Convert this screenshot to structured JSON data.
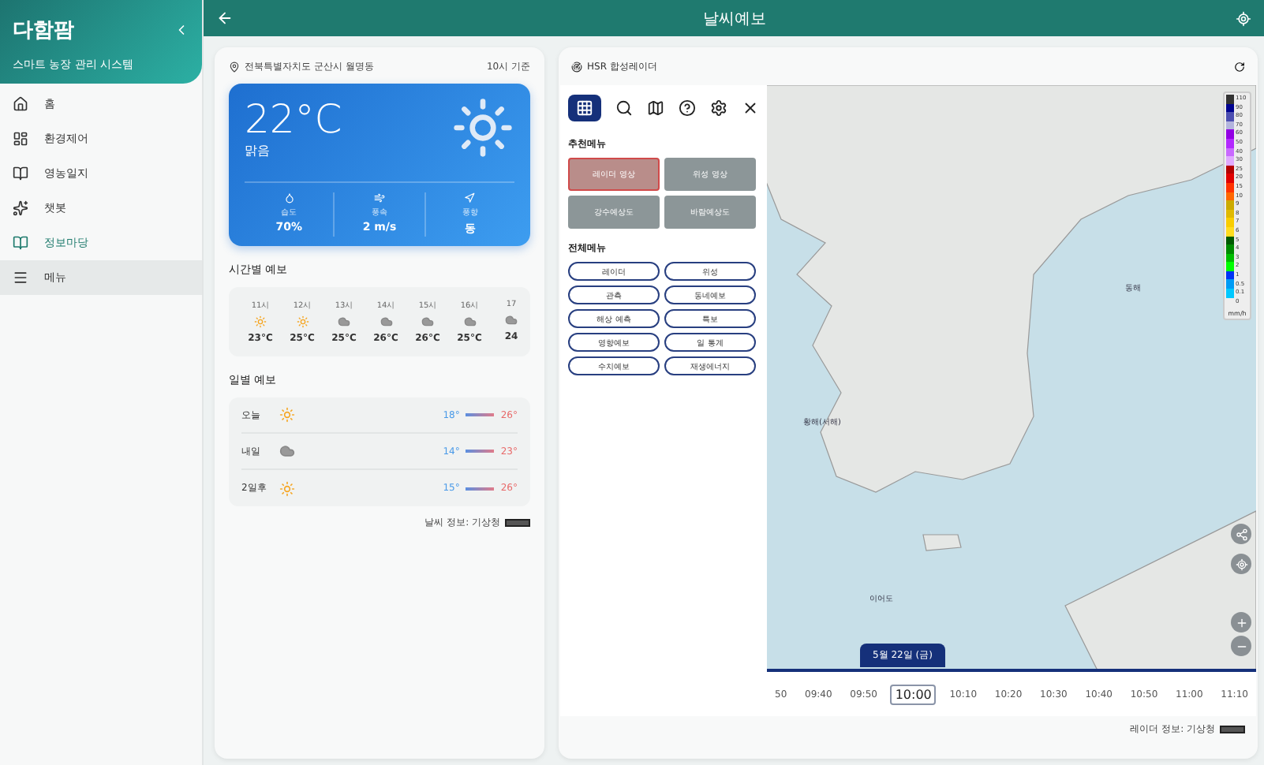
{
  "sidebar": {
    "brand": "다함팜",
    "subtitle": "스마트 농장 관리 시스템",
    "items": [
      {
        "label": "홈",
        "selected": false,
        "highlighted": false
      },
      {
        "label": "환경제어",
        "selected": false,
        "highlighted": false
      },
      {
        "label": "영농일지",
        "selected": false,
        "highlighted": false
      },
      {
        "label": "챗봇",
        "selected": false,
        "highlighted": false
      },
      {
        "label": "정보마당",
        "selected": true,
        "highlighted": false
      },
      {
        "label": "메뉴",
        "selected": false,
        "highlighted": true
      }
    ]
  },
  "top_bar": {
    "title": "날씨예보"
  },
  "weather": {
    "location": "전북특별자치도 군산시 월명동",
    "basis": "10시 기준",
    "temperature": "22°C",
    "condition": "맑음",
    "stats": [
      {
        "kind": "humidity",
        "label": "습도",
        "value": "70%"
      },
      {
        "kind": "wind",
        "label": "풍속",
        "value": "2 m/s"
      },
      {
        "kind": "direction",
        "label": "풍향",
        "value": "동"
      }
    ],
    "hourly_title": "시간별 예보",
    "hourly": [
      {
        "time": "11시",
        "kind": "sun",
        "temp": "23°C"
      },
      {
        "time": "12시",
        "kind": "sun",
        "temp": "25°C"
      },
      {
        "time": "13시",
        "kind": "cloud",
        "temp": "25°C"
      },
      {
        "time": "14시",
        "kind": "cloud",
        "temp": "26°C"
      },
      {
        "time": "15시",
        "kind": "cloud",
        "temp": "26°C"
      },
      {
        "time": "16시",
        "kind": "cloud",
        "temp": "25°C"
      },
      {
        "time": "17",
        "kind": "cloud",
        "temp": "24"
      }
    ],
    "daily_title": "일별 예보",
    "daily": [
      {
        "day": "오늘",
        "kind": "sun",
        "low": "18°",
        "high": "26°"
      },
      {
        "day": "내일",
        "kind": "cloud",
        "low": "14°",
        "high": "23°"
      },
      {
        "day": "2일후",
        "kind": "sun",
        "low": "15°",
        "high": "26°"
      }
    ],
    "source": "날씨 정보: 기상청"
  },
  "radar": {
    "title": "HSR 합성레이더",
    "tools": [
      {
        "kind": "grid",
        "selected": true
      },
      {
        "kind": "search",
        "selected": false
      },
      {
        "kind": "map",
        "selected": false
      },
      {
        "kind": "help",
        "selected": false
      },
      {
        "kind": "settings",
        "selected": false
      }
    ],
    "recommended_title": "추천메뉴",
    "recommended": [
      {
        "label": "레이더 영상",
        "selected": true
      },
      {
        "label": "위성 영상",
        "selected": false
      },
      {
        "label": "강수예상도",
        "selected": false
      },
      {
        "label": "바람예상도",
        "selected": false
      }
    ],
    "all_title": "전체메뉴",
    "all_menu": [
      "레이더",
      "위성",
      "관측",
      "동네예보",
      "해상 예측",
      "특보",
      "영향예보",
      "일 통계",
      "수치예보",
      "재생에너지"
    ],
    "map_labels": [
      {
        "kind": "east",
        "text": "동해"
      },
      {
        "kind": "west",
        "text": "황해(서해)"
      },
      {
        "kind": "south",
        "text": "이어도"
      }
    ],
    "legend": [
      {
        "value": "110",
        "color": "#333333"
      },
      {
        "value": "90",
        "color": "#000390"
      },
      {
        "value": "80",
        "color": "#4c4eb1"
      },
      {
        "value": "70",
        "color": "#b3b4de"
      },
      {
        "value": "60",
        "color": "#9300e4"
      },
      {
        "value": "50",
        "color": "#b329ff"
      },
      {
        "value": "40",
        "color": "#c969ff"
      },
      {
        "value": "30",
        "color": "#e0a9ff"
      },
      {
        "value": "25",
        "color": "#b40000"
      },
      {
        "value": "20",
        "color": "#e00000"
      },
      {
        "value": "15",
        "color": "#ff3200"
      },
      {
        "value": "10",
        "color": "#ff6600"
      },
      {
        "value": "9",
        "color": "#ccaa00"
      },
      {
        "value": "8",
        "color": "#e0b900"
      },
      {
        "value": "7",
        "color": "#f9cd00"
      },
      {
        "value": "6",
        "color": "#ffdc1f"
      },
      {
        "value": "5",
        "color": "#005a00"
      },
      {
        "value": "4",
        "color": "#008c00"
      },
      {
        "value": "3",
        "color": "#00be00"
      },
      {
        "value": "2",
        "color": "#00ff00"
      },
      {
        "value": "1",
        "color": "#0033f5"
      },
      {
        "value": "0.5",
        "color": "#009bf5"
      },
      {
        "value": "0.1",
        "color": "#00c8ff"
      },
      {
        "value": "0",
        "color": "#eeeeee"
      }
    ],
    "legend_unit": "mm/h",
    "date": "5월 22일 (금)",
    "times": [
      {
        "label": "50",
        "selected": false
      },
      {
        "label": "09:40",
        "selected": false
      },
      {
        "label": "09:50",
        "selected": false
      },
      {
        "label": "10:00",
        "selected": true
      },
      {
        "label": "10:10",
        "selected": false
      },
      {
        "label": "10:20",
        "selected": false
      },
      {
        "label": "10:30",
        "selected": false
      },
      {
        "label": "10:40",
        "selected": false
      },
      {
        "label": "10:50",
        "selected": false
      },
      {
        "label": "11:00",
        "selected": false
      },
      {
        "label": "11:10",
        "selected": false
      }
    ],
    "source": "레이더 정보: 기상청"
  }
}
